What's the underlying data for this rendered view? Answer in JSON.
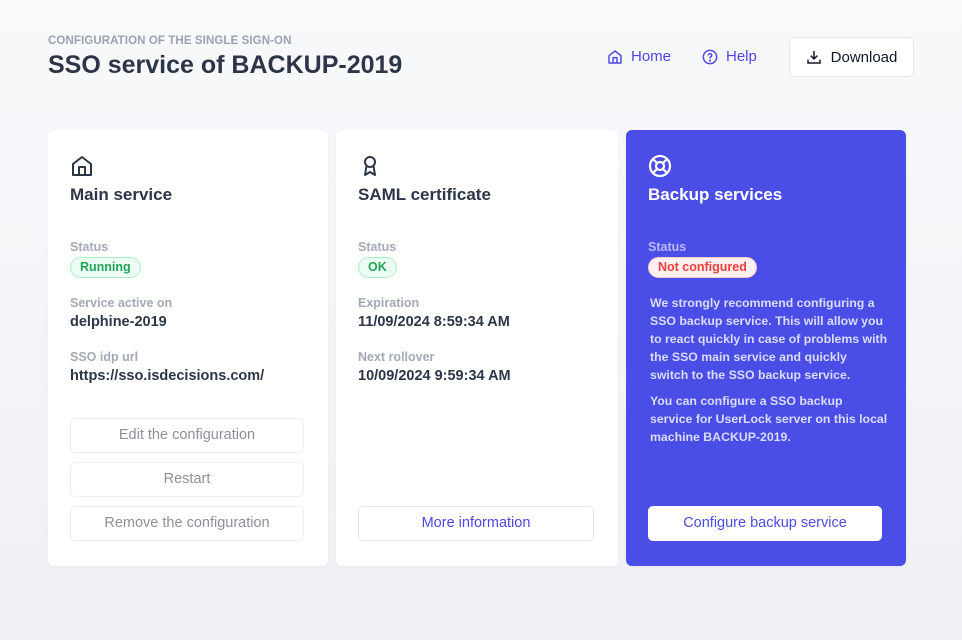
{
  "header": {
    "subtitle": "CONFIGURATION OF THE SINGLE SIGN-ON",
    "title": "SSO service of BACKUP-2019",
    "home": "Home",
    "help": "Help",
    "download": "Download"
  },
  "main": {
    "title": "Main service",
    "status_label": "Status",
    "status": "Running",
    "active_label": "Service active on",
    "active": "delphine-2019",
    "url_label": "SSO idp url",
    "url": "https://sso.isdecisions.com/",
    "buttons": [
      "Edit the configuration",
      "Restart",
      "Remove the configuration"
    ]
  },
  "saml": {
    "title": "SAML certificate",
    "status_label": "Status",
    "status": "OK",
    "exp_label": "Expiration",
    "exp": "11/09/2024 8:59:34 AM",
    "roll_label": "Next rollover",
    "roll": "10/09/2024 9:59:34 AM",
    "button": "More information"
  },
  "backup": {
    "title": "Backup services",
    "status_label": "Status",
    "status": "Not configured",
    "p1": "We strongly recommend configuring a SSO backup service. This will allow you to react quickly in case of problems with the SSO main service and quickly switch to the SSO backup service.",
    "p2": "You can configure a SSO backup service for UserLock server on this local machine BACKUP-2019.",
    "button": "Configure backup service"
  },
  "colors": {
    "accent": "#4a4de6",
    "success": "#1fa65a",
    "danger": "#ef3d3d"
  }
}
